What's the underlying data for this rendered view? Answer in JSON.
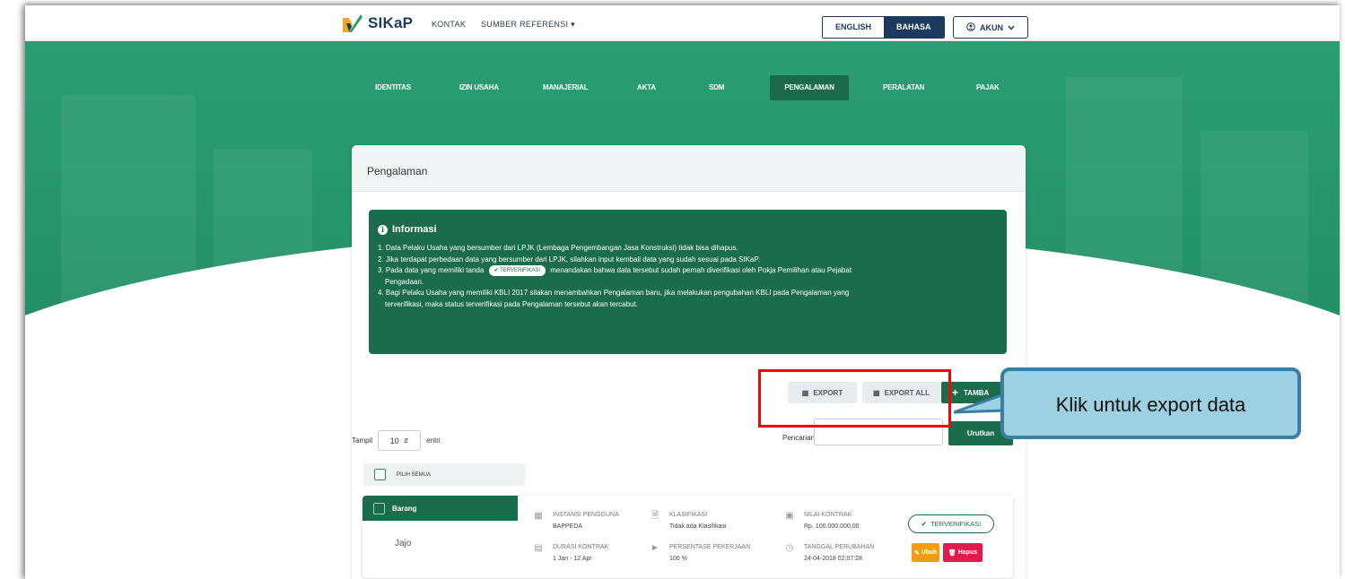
{
  "brand": {
    "logo_text": "SIKaP"
  },
  "topnav": {
    "kontak": "KONTAK",
    "sumber_referensi": "SUMBER REFERENSI"
  },
  "lang": {
    "english": "ENGLISH",
    "bahasa": "BAHASA",
    "active": "BAHASA"
  },
  "account": {
    "label": "AKUN"
  },
  "tabs": [
    {
      "label": "IDENTITAS"
    },
    {
      "label": "IZIN USAHA"
    },
    {
      "label": "MANAJERIAL"
    },
    {
      "label": "AKTA"
    },
    {
      "label": "SDM"
    },
    {
      "label": "PENGALAMAN",
      "active": true
    },
    {
      "label": "PERALATAN"
    },
    {
      "label": "PAJAK"
    }
  ],
  "card": {
    "title": "Pengalaman"
  },
  "info": {
    "title": "Informasi",
    "line1": "1. Data Pelaku Usaha yang bersumber dari LPJK (Lembaga Pengembangan Jasa Konstruksi) tidak bisa dihapus.",
    "line2": "2. Jika terdapat perbedaan data yang bersumber dari LPJK, silahkan input kembali data yang sudah sesuai pada SIKaP.",
    "line3a": "3. Pada data yang memiliki tanda",
    "line3_badge": "TERVERIFIKASI",
    "line3b": "menandakan bahwa data tersebut sudah pernah diverifikasi oleh Pokja Pemilihan atau Pejabat",
    "line3c": "Pengadaan.",
    "line4a": "4. Bagi Pelaku Usaha yang memiliki KBLI 2017 silakan menambahkan Pengalaman baru, jika melakukan pengubahan KBLI pada Pengalaman yang",
    "line4b": "terverifikasi, maka status terverifikasi pada Pengalaman tersebut akan tercabut."
  },
  "actions": {
    "export": "EXPORT",
    "export_all": "EXPORT ALL",
    "add": "TAMBA"
  },
  "table_controls": {
    "show_label": "Tampil",
    "page_size": "10",
    "entries_label": "entri",
    "search_label": "Pencarian",
    "search_value": "",
    "sort_label": "Urutkan"
  },
  "select_all": {
    "label": "PILIH SEMUA"
  },
  "record": {
    "category": "Barang",
    "name": "Jajo",
    "fields": {
      "instansi_label": "INSTANSI PENGGUNA",
      "instansi_value": "BAPPEDA",
      "klasifikasi_label": "KLASIFIKASI",
      "klasifikasi_value": "Tidak ada Klasifikasi",
      "nilai_label": "NILAI KONTRAK",
      "nilai_value": "Rp. 100.000.000,00",
      "durasi_label": "DURASI KONTRAK",
      "durasi_value": "1 Jan - 12 Apr",
      "persentase_label": "PERSENTASE PEKERJAAN",
      "persentase_value": "100 %",
      "tanggal_label": "TANGGAL PERUBAHAN",
      "tanggal_value": "24-04-2018 02:07:28"
    },
    "status": "TERVERIFIKASI",
    "edit_label": "Ubah",
    "delete_label": "Hapus"
  },
  "annotation": {
    "callout_text": "Klik untuk export data"
  },
  "colors": {
    "primary_green": "#1b6c4d",
    "hero_green": "#2a9d73",
    "highlight_red": "#ff0000",
    "callout_fill": "#9dd0e0",
    "callout_border": "#3a7fa1",
    "edit_orange": "#f39c12",
    "delete_red": "#e31b4d"
  }
}
